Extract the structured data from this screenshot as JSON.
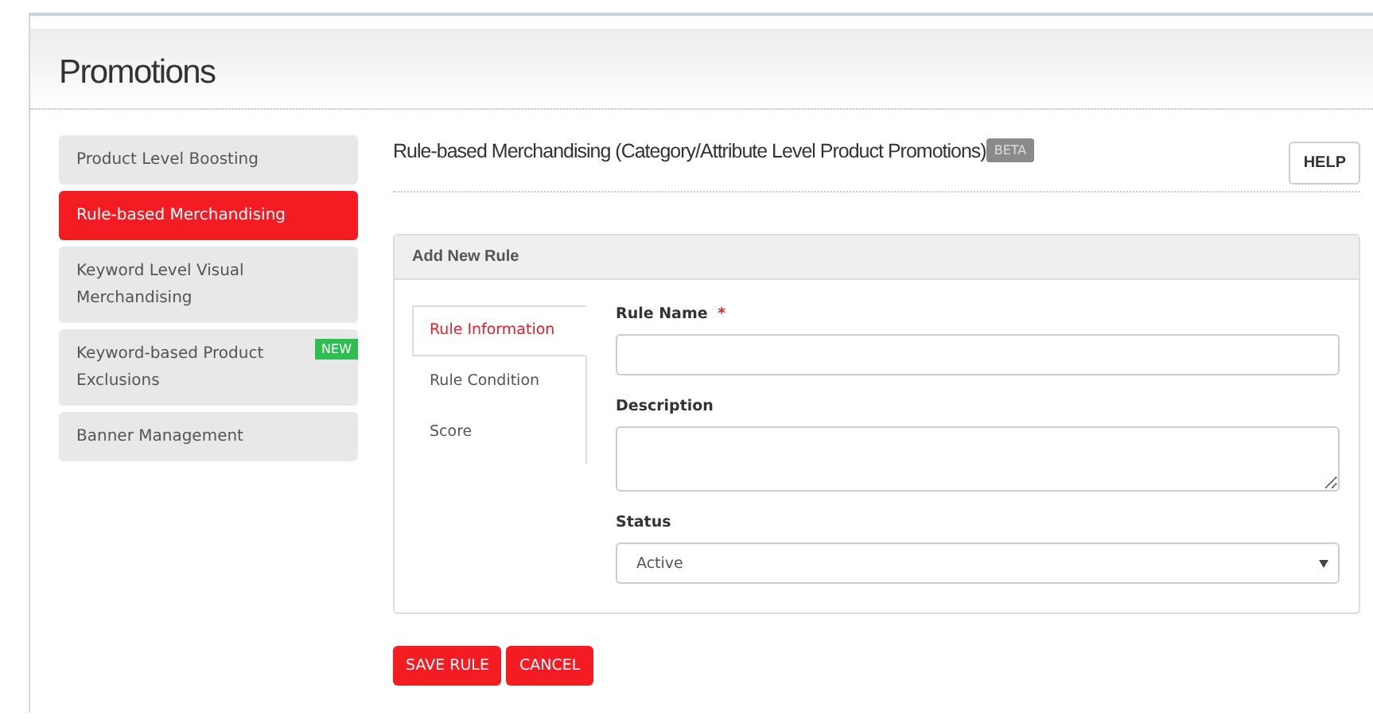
{
  "page": {
    "title": "Promotions"
  },
  "sidebar": {
    "items": [
      {
        "label": "Product Level Boosting",
        "selected": false
      },
      {
        "label": "Rule-based Merchandising",
        "selected": true
      },
      {
        "label": "Keyword Level Visual Merchandising",
        "selected": false
      },
      {
        "label": "Keyword-based Product Exclusions",
        "selected": false,
        "badge": "NEW"
      },
      {
        "label": "Banner Management",
        "selected": false
      }
    ]
  },
  "main": {
    "heading": "Rule-based Merchandising (Category/Attribute Level Product Promotions)",
    "heading_badge": "BETA",
    "help_button": "HELP",
    "panel": {
      "title": "Add New Rule",
      "tabs": [
        {
          "label": "Rule Information",
          "selected": true
        },
        {
          "label": "Rule Condition",
          "selected": false
        },
        {
          "label": "Score",
          "selected": false
        }
      ],
      "fields": [
        {
          "kind": "text",
          "label": "Rule Name",
          "required_mark": "*"
        },
        {
          "kind": "textarea",
          "label": "Description"
        },
        {
          "kind": "select",
          "label": "Status",
          "value": "Active"
        }
      ]
    },
    "buttons": [
      "SAVE RULE",
      "CANCEL"
    ]
  }
}
